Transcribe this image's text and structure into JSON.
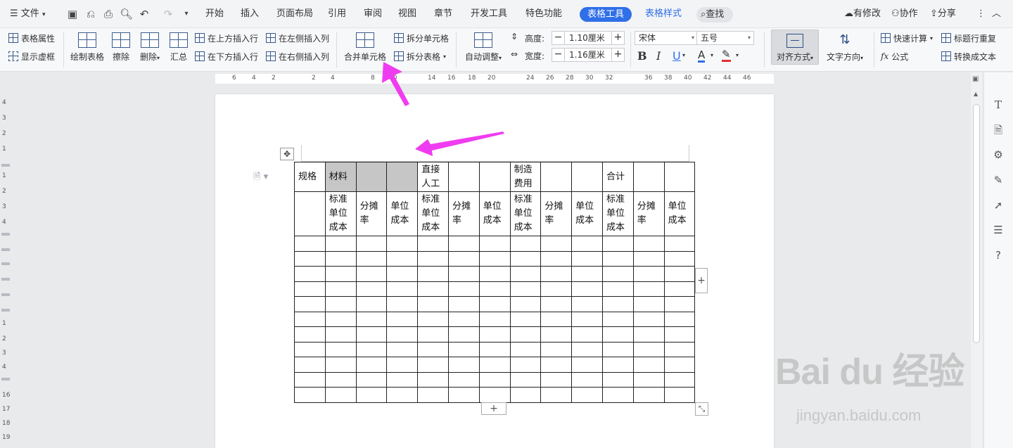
{
  "tabbar": {
    "menu_label": "文件",
    "tabs": [
      "开始",
      "插入",
      "页面布局",
      "引用",
      "审阅",
      "视图",
      "章节",
      "开发工具",
      "特色功能"
    ],
    "active_tab": "表格工具",
    "context_tab": "表格样式",
    "search_label": "查找",
    "right_items": [
      "有修改",
      "协作",
      "分享"
    ]
  },
  "ribbon": {
    "table_props": "表格属性",
    "show_gridlines": "显示虚框",
    "draw_table": "绘制表格",
    "erase": "擦除",
    "delete": "删除",
    "summary": "汇总",
    "insert_above": "在上方插入行",
    "insert_below": "在下方插入行",
    "insert_left": "在左侧插入列",
    "insert_right": "在右侧插入列",
    "merge_cells": "合并单元格",
    "split_cells": "拆分单元格",
    "split_table": "拆分表格",
    "auto_fit": "自动调整",
    "height_label": "高度:",
    "height_value": "1.10厘米",
    "width_label": "宽度:",
    "width_value": "1.16厘米",
    "font_name": "宋体",
    "font_size": "五号",
    "bold": "B",
    "italic": "I",
    "underline": "U",
    "align": "对齐方式",
    "text_direction": "文字方向",
    "quick_calc": "快速计算",
    "formula": "公式",
    "repeat_header": "标题行重复",
    "convert_text": "转换成文本"
  },
  "ruler": {
    "h_ticks": [
      "6",
      "4",
      "2",
      "2",
      "4",
      "8",
      "10",
      "14",
      "16",
      "18",
      "20",
      "24",
      "26",
      "28",
      "30",
      "32",
      "36",
      "38",
      "40",
      "42",
      "44",
      "46"
    ],
    "v_ticks": [
      "4",
      "3",
      "2",
      "1",
      "1",
      "2",
      "3",
      "4",
      "1",
      "2",
      "3",
      "4",
      "16",
      "17",
      "18",
      "19"
    ]
  },
  "table": {
    "header_row_1": [
      "规格",
      "材料",
      "",
      "",
      "直接人工",
      "",
      "",
      "制造费用",
      "",
      "",
      "合计",
      "",
      ""
    ],
    "header_row_2": [
      "",
      "标准单位成本",
      "分摊率",
      "单位成本",
      "标准单位成本",
      "分摊率",
      "单位成本",
      "标准单位成本",
      "分摊率",
      "单位成本",
      "标准单位成本",
      "分摊率",
      "单位成本"
    ],
    "selected_cells_row_1": [
      1,
      2,
      3
    ],
    "empty_rows": 11,
    "columns": 13
  },
  "watermark": {
    "brand": "Bai du 经验",
    "url": "jingyan.baidu.com"
  },
  "colors": {
    "accent": "#2f6fe8",
    "arrow": "#f03cf0",
    "selected_cell": "#c6c6c6"
  }
}
